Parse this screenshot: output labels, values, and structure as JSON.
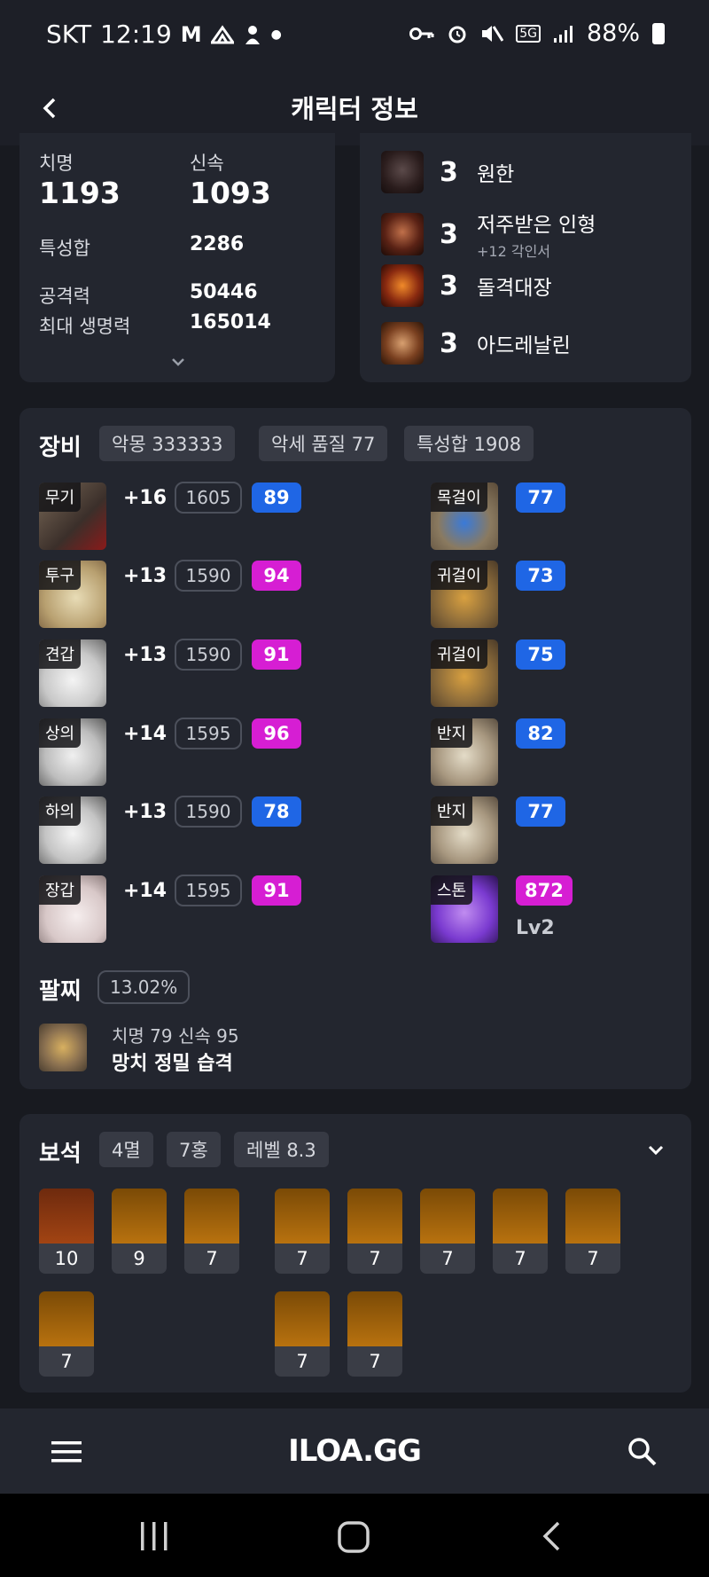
{
  "status_bar": {
    "carrier": "SKT",
    "time": "12:19",
    "battery": "88%"
  },
  "header": {
    "title": "캐릭터 정보"
  },
  "stats": {
    "crit_label": "치명",
    "crit_value": "1193",
    "swift_label": "신속",
    "swift_value": "1093",
    "total_label": "특성합",
    "total_value": "2286",
    "atk_label": "공격력",
    "atk_value": "50446",
    "hp_label": "최대 생명력",
    "hp_value": "165014"
  },
  "engravings": [
    {
      "level": "3",
      "name": "원한",
      "sub": ""
    },
    {
      "level": "3",
      "name": "저주받은 인형",
      "sub": "+12 각인서"
    },
    {
      "level": "3",
      "name": "돌격대장",
      "sub": ""
    },
    {
      "level": "3",
      "name": "아드레날린",
      "sub": ""
    }
  ],
  "equipment": {
    "title": "장비",
    "chips": [
      "악몽 333333",
      "악세 품질 77",
      "특성합 1908"
    ],
    "left": [
      {
        "tag": "무기",
        "refine": "+16",
        "ilvl": "1605",
        "quality": "89"
      },
      {
        "tag": "투구",
        "refine": "+13",
        "ilvl": "1590",
        "quality": "94"
      },
      {
        "tag": "견갑",
        "refine": "+13",
        "ilvl": "1590",
        "quality": "91"
      },
      {
        "tag": "상의",
        "refine": "+14",
        "ilvl": "1595",
        "quality": "96"
      },
      {
        "tag": "하의",
        "refine": "+13",
        "ilvl": "1590",
        "quality": "78"
      },
      {
        "tag": "장갑",
        "refine": "+14",
        "ilvl": "1595",
        "quality": "91"
      }
    ],
    "right": [
      {
        "tag": "목걸이",
        "quality": "77"
      },
      {
        "tag": "귀걸이",
        "quality": "73"
      },
      {
        "tag": "귀걸이",
        "quality": "75"
      },
      {
        "tag": "반지",
        "quality": "82"
      },
      {
        "tag": "반지",
        "quality": "77"
      },
      {
        "tag": "스톤",
        "quality": "872",
        "extra": "Lv2"
      }
    ]
  },
  "bracelet": {
    "title": "팔찌",
    "percent": "13.02%",
    "stats": "치명 79  신속 95",
    "effects": "망치  정밀  습격"
  },
  "gems": {
    "title": "보석",
    "chips": [
      "4멸",
      "7홍",
      "레벨 8.3"
    ],
    "row1": [
      "10",
      "9",
      "7",
      "7",
      "7",
      "7",
      "7",
      "7"
    ],
    "row2": [
      "7",
      "7",
      "7"
    ]
  },
  "app_bar": {
    "brand": "ILOA.GG"
  },
  "colors": {
    "background": "#181a20",
    "card": "#23262f",
    "quality_blue": "#1f66e5",
    "quality_pink": "#d61ed3"
  }
}
